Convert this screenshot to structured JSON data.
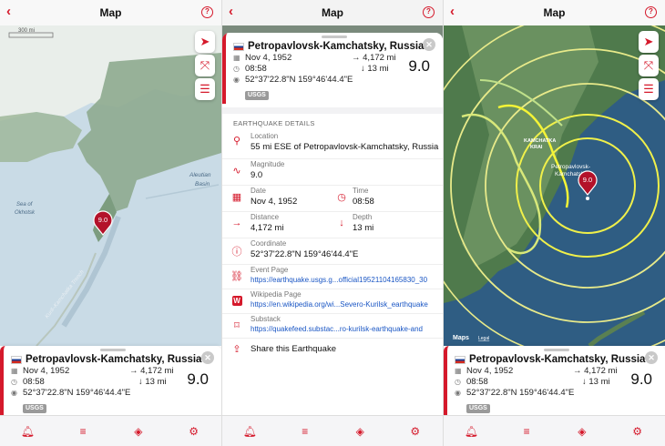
{
  "nav": {
    "title": "Map",
    "back": "‹",
    "help": "?"
  },
  "colors": {
    "accent": "#d5192b",
    "ocean": "#c7dbe7",
    "land": "#8fae9a",
    "link": "#1a56c4"
  },
  "map1": {
    "scale_label": "300 mi",
    "labels": {
      "sea": "Sea of\nOkhotsk",
      "sea_l1": "Sea of",
      "sea_l2": "Okhotsk",
      "basin_l1": "Aleutian",
      "basin_l2": "Basin",
      "trench": "Kuril–Kamchatka Trench"
    },
    "pin_label": "9.0",
    "controls": [
      "location-arrow-icon",
      "expand-icon",
      "list-icon"
    ]
  },
  "map3": {
    "pin_label": "9.0",
    "place_label_l1": "Petropavlovsk-",
    "place_label_l2": "Kamchatskiy",
    "region_label_l1": "KAMCHATKA",
    "region_label_l2": "KRAI",
    "maps_brand": "Maps",
    "legal": "Legal"
  },
  "quake": {
    "title": "Petropavlovsk-Kamchatsky, Russia",
    "date": "Nov 4, 1952",
    "time": "08:58",
    "coordinate": "52°37'22.8\"N 159°46'44.4\"E",
    "source": "USGS",
    "distance": "4,172 mi",
    "depth": "13 mi",
    "magnitude": "9.0",
    "dist_arrow": "→",
    "depth_arrow": "↓"
  },
  "details": {
    "header": "EARTHQUAKE DETAILS",
    "location_label": "Location",
    "location_value": "55 mi ESE of Petropavlovsk-Kamchatsky, Russia",
    "magnitude_label": "Magnitude",
    "magnitude_value": "9.0",
    "date_label": "Date",
    "date_value": "Nov 4, 1952",
    "time_label": "Time",
    "time_value": "08:58",
    "distance_label": "Distance",
    "distance_value": "4,172 mi",
    "depth_label": "Depth",
    "depth_value": "13 mi",
    "coordinate_label": "Coordinate",
    "coordinate_value": "52°37'22.8\"N 159°46'44.4\"E",
    "event_label": "Event Page",
    "event_link": "https://earthquake.usgs.g...official19521104165830_30",
    "wiki_label": "Wikipedia Page",
    "wiki_link": "https://en.wikipedia.org/wi...Severo-Kurilsk_earthquake",
    "substack_label": "Substack",
    "substack_link": "https://quakefeed.substac...ro-kurilsk-earthquake-and",
    "share_label": "Share this Earthquake"
  },
  "tabs": [
    "bell-icon",
    "list-icon",
    "layers-icon",
    "settings-icon"
  ]
}
